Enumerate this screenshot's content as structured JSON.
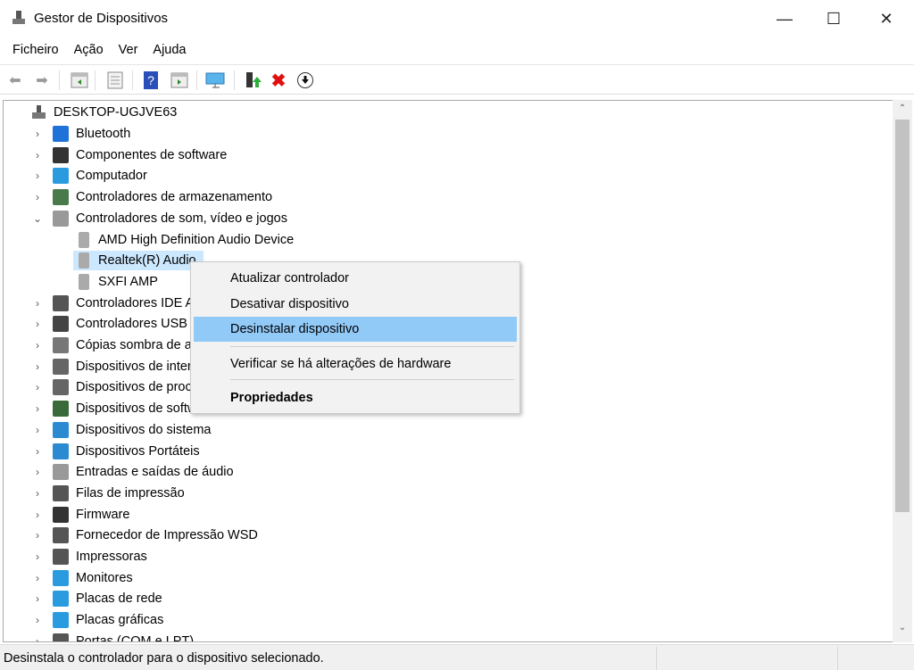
{
  "window": {
    "title": "Gestor de Dispositivos",
    "minimize": "—",
    "maximize": "☐",
    "close": "✕"
  },
  "menu": [
    "Ficheiro",
    "Ação",
    "Ver",
    "Ajuda"
  ],
  "toolbar": [
    "back-icon",
    "forward-icon",
    "show-hide-console-tree-icon",
    "properties-icon",
    "help-icon",
    "action-pane-icon",
    "scan-hardware-icon",
    "update-driver-icon",
    "uninstall-icon",
    "download-icon"
  ],
  "tree": {
    "root": "DESKTOP-UGJVE63",
    "items": [
      {
        "label": "Bluetooth",
        "icon": "bluetooth-icon",
        "color": "#1e72d8"
      },
      {
        "label": "Componentes de software",
        "icon": "software-component-icon",
        "color": "#333"
      },
      {
        "label": "Computador",
        "icon": "computer-icon",
        "color": "#2b9be0"
      },
      {
        "label": "Controladores de armazenamento",
        "icon": "storage-icon",
        "color": "#4a7a4a"
      },
      {
        "label": "Controladores de som, vídeo e jogos",
        "icon": "speaker-icon",
        "color": "#999",
        "expanded": true,
        "children": [
          {
            "label": "AMD High Definition Audio Device"
          },
          {
            "label": "Realtek(R) Audio",
            "selected": true
          },
          {
            "label": "SXFI AMP"
          }
        ]
      },
      {
        "label": "Controladores IDE ATA/ATAPI",
        "icon": "ide-icon",
        "color": "#555"
      },
      {
        "label": "Controladores USB (Universal Serial Bus)",
        "icon": "usb-icon",
        "color": "#444"
      },
      {
        "label": "Cópias sombra de armazenamento",
        "icon": "shadow-copy-icon",
        "color": "#777"
      },
      {
        "label": "Dispositivos de interface humana",
        "icon": "hid-icon",
        "color": "#666"
      },
      {
        "label": "Dispositivos de processamento",
        "icon": "processor-icon",
        "color": "#666"
      },
      {
        "label": "Dispositivos de software",
        "icon": "software-device-icon",
        "color": "#3a6a3a"
      },
      {
        "label": "Dispositivos do sistema",
        "icon": "system-device-icon",
        "color": "#2b8ad0"
      },
      {
        "label": "Dispositivos Portáteis",
        "icon": "portable-device-icon",
        "color": "#2b8ad0"
      },
      {
        "label": "Entradas e saídas de áudio",
        "icon": "audio-io-icon",
        "color": "#999"
      },
      {
        "label": "Filas de impressão",
        "icon": "print-queue-icon",
        "color": "#555"
      },
      {
        "label": "Firmware",
        "icon": "firmware-icon",
        "color": "#333"
      },
      {
        "label": "Fornecedor de Impressão WSD",
        "icon": "wsd-printer-icon",
        "color": "#555"
      },
      {
        "label": "Impressoras",
        "icon": "printer-icon",
        "color": "#555"
      },
      {
        "label": "Monitores",
        "icon": "monitor-icon",
        "color": "#2b9be0"
      },
      {
        "label": "Placas de rede",
        "icon": "network-adapter-icon",
        "color": "#2b9be0"
      },
      {
        "label": "Placas gráficas",
        "icon": "display-adapter-icon",
        "color": "#2b9be0"
      },
      {
        "label": "Portas (COM e LPT)",
        "icon": "port-icon",
        "color": "#555"
      }
    ]
  },
  "context_menu": {
    "items": [
      "Atualizar controlador",
      "Desativar dispositivo",
      "Desinstalar dispositivo",
      "Verificar se há alterações de hardware",
      "Propriedades"
    ],
    "highlighted": "Desinstalar dispositivo",
    "highlight_color": "#91c9f7"
  },
  "status": "Desinstala o controlador para o dispositivo selecionado."
}
